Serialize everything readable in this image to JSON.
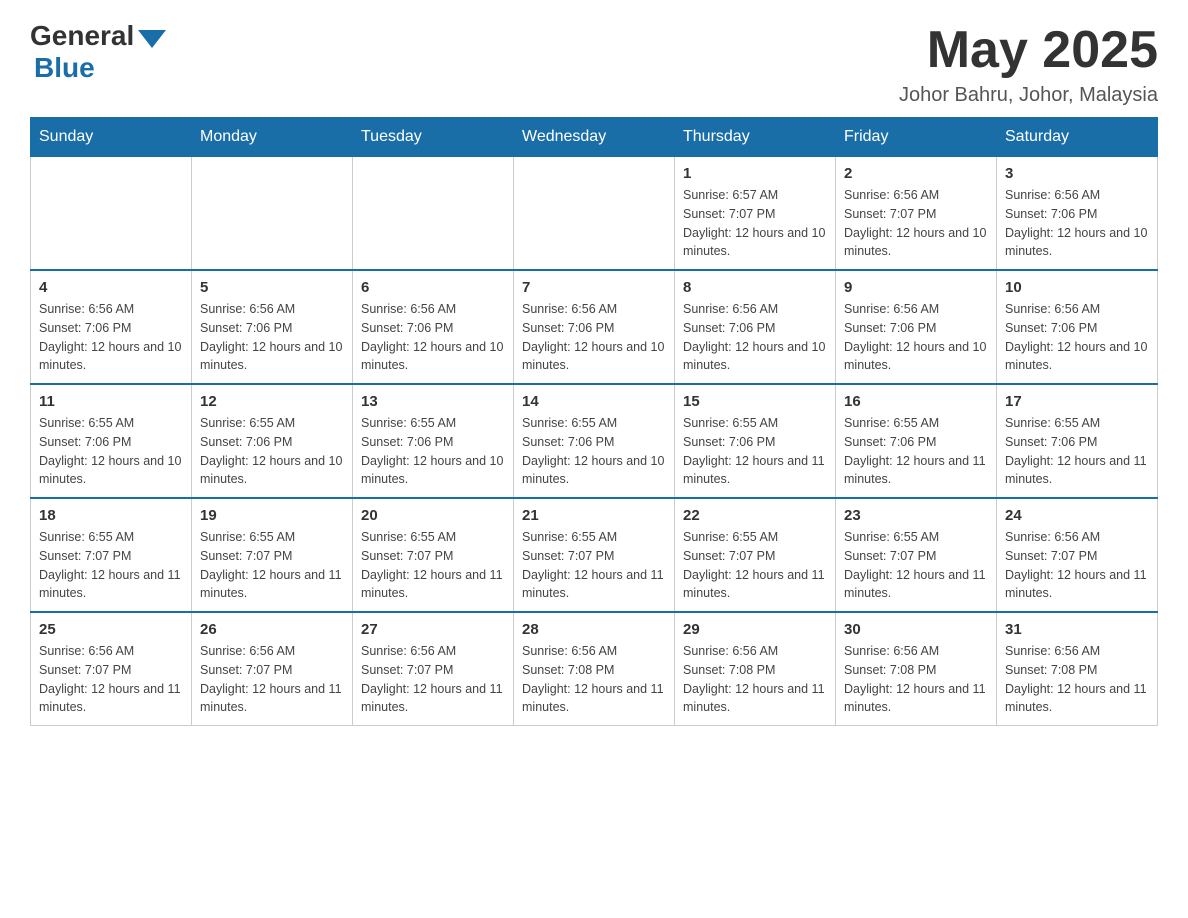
{
  "header": {
    "logo_general": "General",
    "logo_blue": "Blue",
    "month_year": "May 2025",
    "location": "Johor Bahru, Johor, Malaysia"
  },
  "days_of_week": [
    "Sunday",
    "Monday",
    "Tuesday",
    "Wednesday",
    "Thursday",
    "Friday",
    "Saturday"
  ],
  "weeks": [
    [
      {
        "day": "",
        "sunrise": "",
        "sunset": "",
        "daylight": ""
      },
      {
        "day": "",
        "sunrise": "",
        "sunset": "",
        "daylight": ""
      },
      {
        "day": "",
        "sunrise": "",
        "sunset": "",
        "daylight": ""
      },
      {
        "day": "",
        "sunrise": "",
        "sunset": "",
        "daylight": ""
      },
      {
        "day": "1",
        "sunrise": "Sunrise: 6:57 AM",
        "sunset": "Sunset: 7:07 PM",
        "daylight": "Daylight: 12 hours and 10 minutes."
      },
      {
        "day": "2",
        "sunrise": "Sunrise: 6:56 AM",
        "sunset": "Sunset: 7:07 PM",
        "daylight": "Daylight: 12 hours and 10 minutes."
      },
      {
        "day": "3",
        "sunrise": "Sunrise: 6:56 AM",
        "sunset": "Sunset: 7:06 PM",
        "daylight": "Daylight: 12 hours and 10 minutes."
      }
    ],
    [
      {
        "day": "4",
        "sunrise": "Sunrise: 6:56 AM",
        "sunset": "Sunset: 7:06 PM",
        "daylight": "Daylight: 12 hours and 10 minutes."
      },
      {
        "day": "5",
        "sunrise": "Sunrise: 6:56 AM",
        "sunset": "Sunset: 7:06 PM",
        "daylight": "Daylight: 12 hours and 10 minutes."
      },
      {
        "day": "6",
        "sunrise": "Sunrise: 6:56 AM",
        "sunset": "Sunset: 7:06 PM",
        "daylight": "Daylight: 12 hours and 10 minutes."
      },
      {
        "day": "7",
        "sunrise": "Sunrise: 6:56 AM",
        "sunset": "Sunset: 7:06 PM",
        "daylight": "Daylight: 12 hours and 10 minutes."
      },
      {
        "day": "8",
        "sunrise": "Sunrise: 6:56 AM",
        "sunset": "Sunset: 7:06 PM",
        "daylight": "Daylight: 12 hours and 10 minutes."
      },
      {
        "day": "9",
        "sunrise": "Sunrise: 6:56 AM",
        "sunset": "Sunset: 7:06 PM",
        "daylight": "Daylight: 12 hours and 10 minutes."
      },
      {
        "day": "10",
        "sunrise": "Sunrise: 6:56 AM",
        "sunset": "Sunset: 7:06 PM",
        "daylight": "Daylight: 12 hours and 10 minutes."
      }
    ],
    [
      {
        "day": "11",
        "sunrise": "Sunrise: 6:55 AM",
        "sunset": "Sunset: 7:06 PM",
        "daylight": "Daylight: 12 hours and 10 minutes."
      },
      {
        "day": "12",
        "sunrise": "Sunrise: 6:55 AM",
        "sunset": "Sunset: 7:06 PM",
        "daylight": "Daylight: 12 hours and 10 minutes."
      },
      {
        "day": "13",
        "sunrise": "Sunrise: 6:55 AM",
        "sunset": "Sunset: 7:06 PM",
        "daylight": "Daylight: 12 hours and 10 minutes."
      },
      {
        "day": "14",
        "sunrise": "Sunrise: 6:55 AM",
        "sunset": "Sunset: 7:06 PM",
        "daylight": "Daylight: 12 hours and 10 minutes."
      },
      {
        "day": "15",
        "sunrise": "Sunrise: 6:55 AM",
        "sunset": "Sunset: 7:06 PM",
        "daylight": "Daylight: 12 hours and 11 minutes."
      },
      {
        "day": "16",
        "sunrise": "Sunrise: 6:55 AM",
        "sunset": "Sunset: 7:06 PM",
        "daylight": "Daylight: 12 hours and 11 minutes."
      },
      {
        "day": "17",
        "sunrise": "Sunrise: 6:55 AM",
        "sunset": "Sunset: 7:06 PM",
        "daylight": "Daylight: 12 hours and 11 minutes."
      }
    ],
    [
      {
        "day": "18",
        "sunrise": "Sunrise: 6:55 AM",
        "sunset": "Sunset: 7:07 PM",
        "daylight": "Daylight: 12 hours and 11 minutes."
      },
      {
        "day": "19",
        "sunrise": "Sunrise: 6:55 AM",
        "sunset": "Sunset: 7:07 PM",
        "daylight": "Daylight: 12 hours and 11 minutes."
      },
      {
        "day": "20",
        "sunrise": "Sunrise: 6:55 AM",
        "sunset": "Sunset: 7:07 PM",
        "daylight": "Daylight: 12 hours and 11 minutes."
      },
      {
        "day": "21",
        "sunrise": "Sunrise: 6:55 AM",
        "sunset": "Sunset: 7:07 PM",
        "daylight": "Daylight: 12 hours and 11 minutes."
      },
      {
        "day": "22",
        "sunrise": "Sunrise: 6:55 AM",
        "sunset": "Sunset: 7:07 PM",
        "daylight": "Daylight: 12 hours and 11 minutes."
      },
      {
        "day": "23",
        "sunrise": "Sunrise: 6:55 AM",
        "sunset": "Sunset: 7:07 PM",
        "daylight": "Daylight: 12 hours and 11 minutes."
      },
      {
        "day": "24",
        "sunrise": "Sunrise: 6:56 AM",
        "sunset": "Sunset: 7:07 PM",
        "daylight": "Daylight: 12 hours and 11 minutes."
      }
    ],
    [
      {
        "day": "25",
        "sunrise": "Sunrise: 6:56 AM",
        "sunset": "Sunset: 7:07 PM",
        "daylight": "Daylight: 12 hours and 11 minutes."
      },
      {
        "day": "26",
        "sunrise": "Sunrise: 6:56 AM",
        "sunset": "Sunset: 7:07 PM",
        "daylight": "Daylight: 12 hours and 11 minutes."
      },
      {
        "day": "27",
        "sunrise": "Sunrise: 6:56 AM",
        "sunset": "Sunset: 7:07 PM",
        "daylight": "Daylight: 12 hours and 11 minutes."
      },
      {
        "day": "28",
        "sunrise": "Sunrise: 6:56 AM",
        "sunset": "Sunset: 7:08 PM",
        "daylight": "Daylight: 12 hours and 11 minutes."
      },
      {
        "day": "29",
        "sunrise": "Sunrise: 6:56 AM",
        "sunset": "Sunset: 7:08 PM",
        "daylight": "Daylight: 12 hours and 11 minutes."
      },
      {
        "day": "30",
        "sunrise": "Sunrise: 6:56 AM",
        "sunset": "Sunset: 7:08 PM",
        "daylight": "Daylight: 12 hours and 11 minutes."
      },
      {
        "day": "31",
        "sunrise": "Sunrise: 6:56 AM",
        "sunset": "Sunset: 7:08 PM",
        "daylight": "Daylight: 12 hours and 11 minutes."
      }
    ]
  ]
}
